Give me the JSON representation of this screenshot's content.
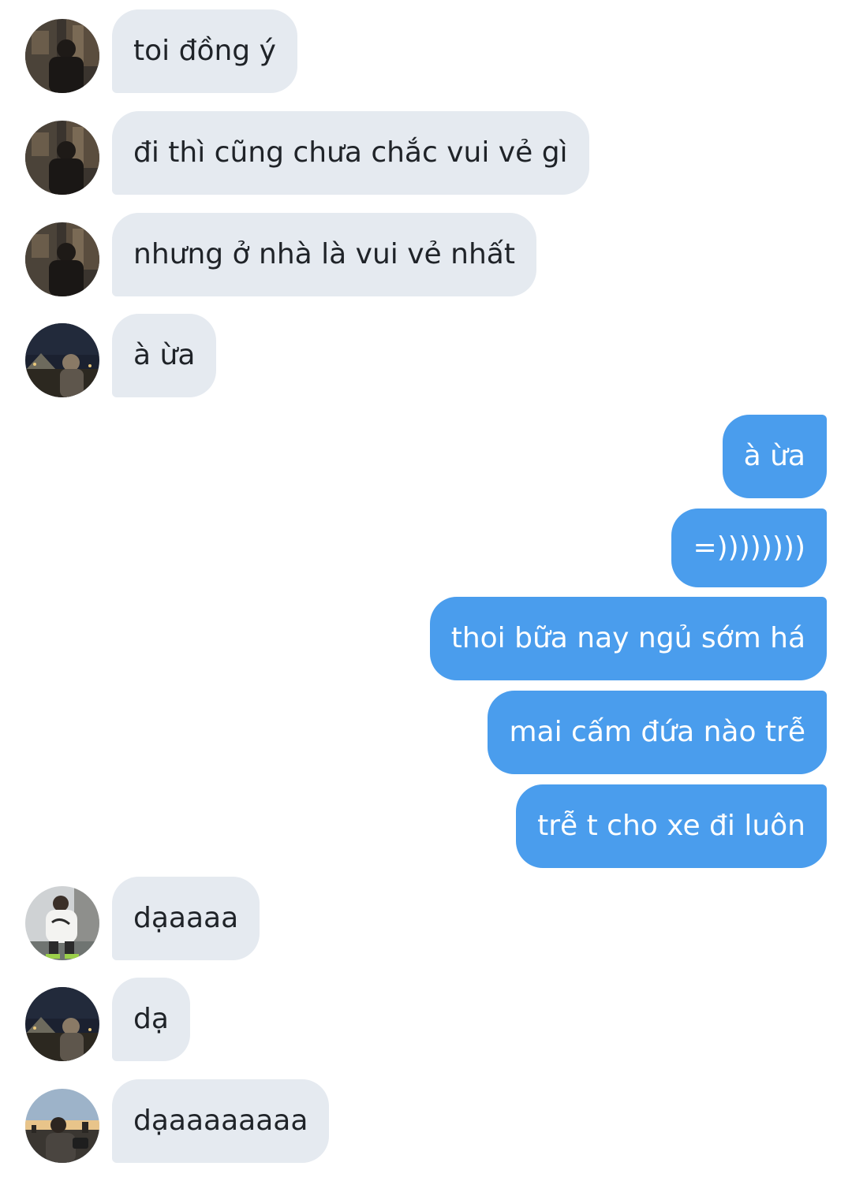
{
  "messages": [
    {
      "side": "in",
      "avatar": "avatar-photo-dark-street",
      "text": "toi đồng ý"
    },
    {
      "side": "in",
      "avatar": "avatar-photo-dark-street",
      "text": "đi thì cũng chưa chắc vui vẻ gì"
    },
    {
      "side": "in",
      "avatar": "avatar-photo-dark-street",
      "text": "nhưng ở nhà là vui vẻ nhất"
    },
    {
      "side": "in",
      "avatar": "avatar-photo-night-louvre",
      "text": "à ừa"
    },
    {
      "side": "out",
      "text": "à ừa"
    },
    {
      "side": "out",
      "text": "=))))))))"
    },
    {
      "side": "out",
      "text": "thoi bữa nay ngủ sớm há"
    },
    {
      "side": "out",
      "text": "mai cấm đứa nào trễ"
    },
    {
      "side": "out",
      "text": "trễ t cho xe đi luôn"
    },
    {
      "side": "in",
      "avatar": "avatar-photo-white-shirt",
      "text": "dạaaaa"
    },
    {
      "side": "in",
      "avatar": "avatar-photo-night-louvre",
      "text": "dạ"
    },
    {
      "side": "in",
      "avatar": "avatar-photo-sunset-city",
      "text": "dạaaaaaaaa"
    }
  ],
  "colors": {
    "incoming_bubble": "#e5eaf0",
    "outgoing_bubble": "#4a9ded",
    "incoming_text": "#1f2328",
    "outgoing_text": "#ffffff",
    "background": "#ffffff"
  }
}
